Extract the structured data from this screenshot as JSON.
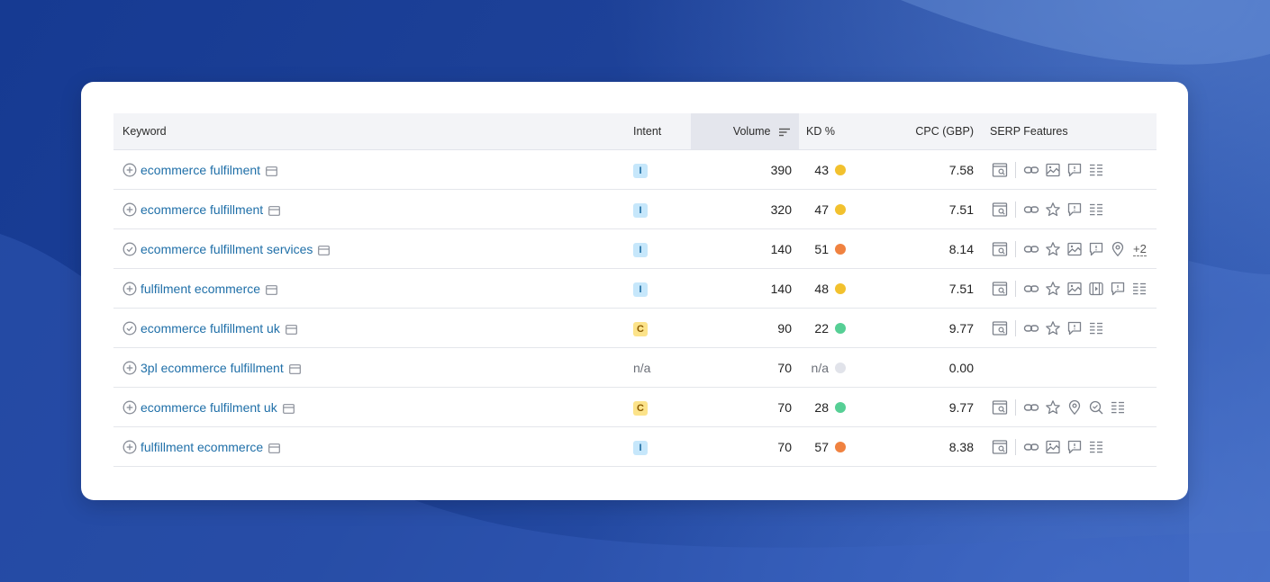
{
  "colors": {
    "link": "#1f6fa8",
    "kd_yellow": "#f2c12e",
    "kd_orange": "#f08240",
    "kd_green": "#56cf95",
    "kd_gray": "#e1e3ea",
    "intent_informational_bg": "#c6e7fb",
    "intent_commercial_bg": "#fce38a"
  },
  "table": {
    "headers": {
      "keyword": "Keyword",
      "intent": "Intent",
      "volume": "Volume",
      "kd": "KD %",
      "cpc": "CPC (GBP)",
      "serp": "SERP Features"
    },
    "rows": [
      {
        "keyword": "ecommerce fulfilment",
        "status": "plus-circle-icon",
        "intent": "I",
        "intent_type": "informational",
        "volume": "390",
        "kd": "43",
        "kd_color": "yellow",
        "cpc": "7.58",
        "serp": [
          "search-result-icon",
          "|",
          "link-icon",
          "image-icon",
          "review-comment-icon",
          "list-icon"
        ],
        "more": ""
      },
      {
        "keyword": "ecommerce fulfillment",
        "status": "plus-circle-icon",
        "intent": "I",
        "intent_type": "informational",
        "volume": "320",
        "kd": "47",
        "kd_color": "yellow",
        "cpc": "7.51",
        "serp": [
          "search-result-icon",
          "|",
          "link-icon",
          "star-icon",
          "review-comment-icon",
          "list-icon"
        ],
        "more": ""
      },
      {
        "keyword": "ecommerce fulfillment services",
        "status": "check-circle-icon",
        "intent": "I",
        "intent_type": "informational",
        "volume": "140",
        "kd": "51",
        "kd_color": "orange",
        "cpc": "8.14",
        "serp": [
          "search-result-icon",
          "|",
          "link-icon",
          "star-icon",
          "image-icon",
          "review-comment-icon",
          "location-pin-icon"
        ],
        "more": "+2"
      },
      {
        "keyword": "fulfilment ecommerce",
        "status": "plus-circle-icon",
        "intent": "I",
        "intent_type": "informational",
        "volume": "140",
        "kd": "48",
        "kd_color": "yellow",
        "cpc": "7.51",
        "serp": [
          "search-result-icon",
          "|",
          "link-icon",
          "star-icon",
          "image-icon",
          "video-icon",
          "review-comment-icon",
          "list-icon"
        ],
        "more": ""
      },
      {
        "keyword": "ecommerce fulfillment uk",
        "status": "check-circle-icon",
        "intent": "C",
        "intent_type": "commercial",
        "volume": "90",
        "kd": "22",
        "kd_color": "green",
        "cpc": "9.77",
        "serp": [
          "search-result-icon",
          "|",
          "link-icon",
          "star-icon",
          "review-comment-icon",
          "list-icon"
        ],
        "more": ""
      },
      {
        "keyword": "3pl ecommerce fulfillment",
        "status": "plus-circle-icon",
        "intent": "n/a",
        "intent_type": "none",
        "volume": "70",
        "kd": "n/a",
        "kd_color": "gray",
        "cpc": "0.00",
        "serp": [],
        "more": ""
      },
      {
        "keyword": "ecommerce fulfilment uk",
        "status": "plus-circle-icon",
        "intent": "C",
        "intent_type": "commercial",
        "volume": "70",
        "kd": "28",
        "kd_color": "green",
        "cpc": "9.77",
        "serp": [
          "search-result-icon",
          "|",
          "link-icon",
          "star-icon",
          "location-pin-icon",
          "search-zoom-icon",
          "list-icon"
        ],
        "more": ""
      },
      {
        "keyword": "fulfillment ecommerce",
        "status": "plus-circle-icon",
        "intent": "I",
        "intent_type": "informational",
        "volume": "70",
        "kd": "57",
        "kd_color": "orange",
        "cpc": "8.38",
        "serp": [
          "search-result-icon",
          "|",
          "link-icon",
          "image-icon",
          "review-comment-icon",
          "list-icon"
        ],
        "more": ""
      }
    ]
  }
}
